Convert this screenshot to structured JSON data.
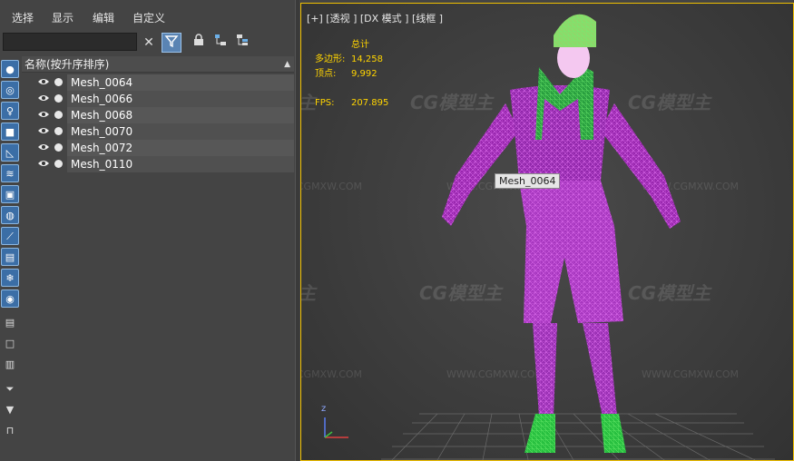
{
  "menu": [
    "选择",
    "显示",
    "编辑",
    "自定义"
  ],
  "search": {
    "value": ""
  },
  "explorer": {
    "header": "名称(按升序排序)",
    "sort_indicator": "▲",
    "rows": [
      "Mesh_0064",
      "Mesh_0066",
      "Mesh_0068",
      "Mesh_0070",
      "Mesh_0072",
      "Mesh_0110"
    ]
  },
  "viewport": {
    "label": "[+] [透视 ] [DX 模式 ] [线框 ]",
    "stats": {
      "total_label": "总计",
      "poly_label": "多边形:",
      "poly_value": "14,258",
      "vert_label": "顶点:",
      "vert_value": "9,992",
      "fps_label": "FPS:",
      "fps_value": "207.895"
    },
    "tooltip": "Mesh_0064",
    "watermark": "CG模型主",
    "watermark_url": "WWW.CGMXW.COM",
    "axis_z": "z"
  },
  "colors": {
    "accent_border": "#f0c000",
    "stats_text": "#ffd400",
    "wire_purple": "#c040d8",
    "wire_green": "#30d040",
    "wire_light_green": "#a8e060"
  }
}
